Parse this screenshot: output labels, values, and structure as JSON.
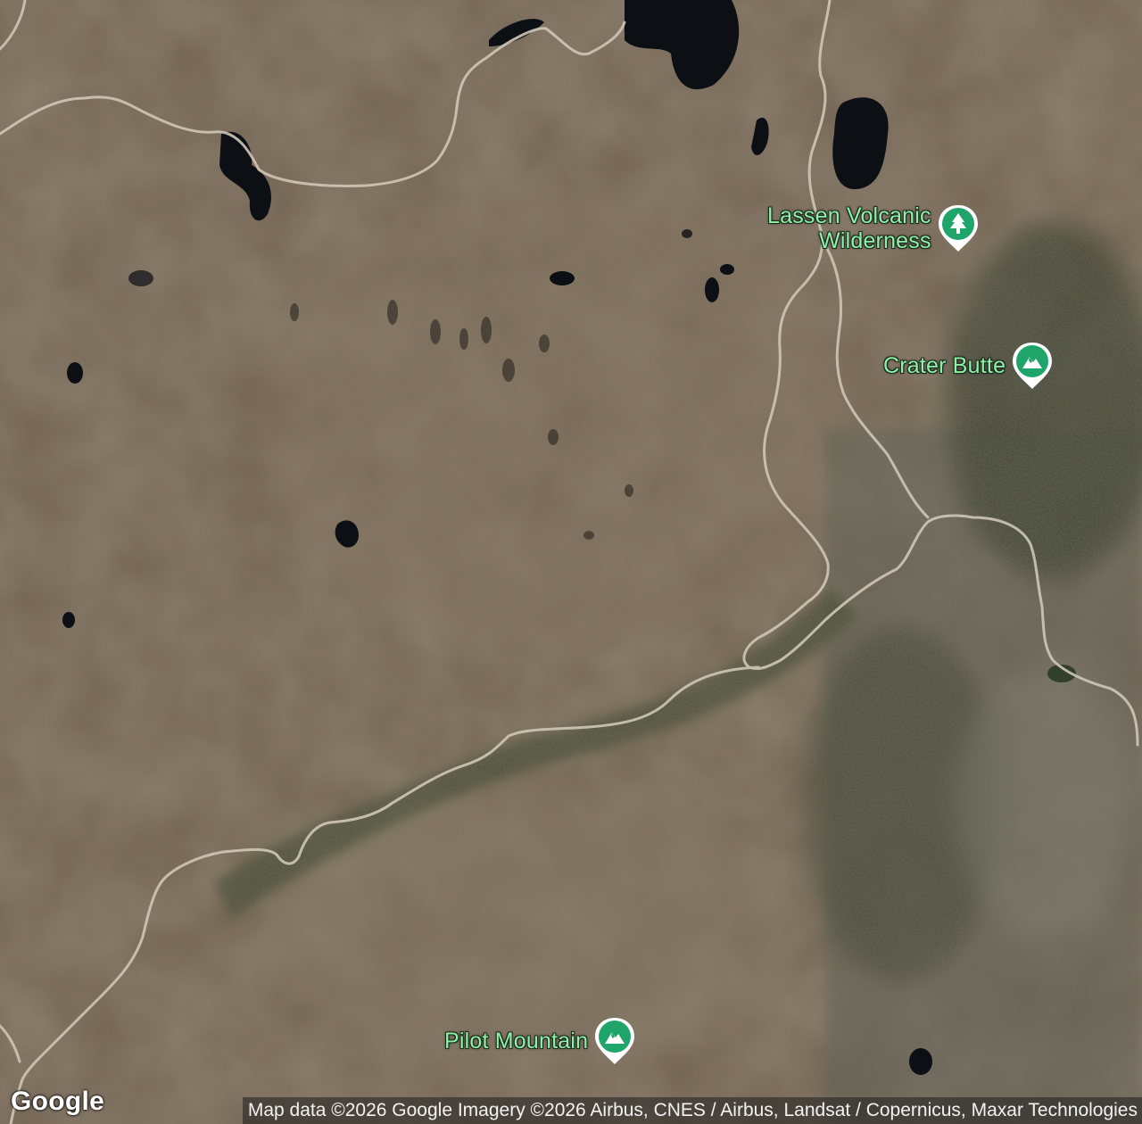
{
  "map": {
    "type": "satellite",
    "colors": {
      "terrain_base": "#6b5a48",
      "forest": "#3e4a35",
      "water": "#0d1115",
      "road": "#cfc6b7",
      "poi_label": "#8ff0a8",
      "poi_pin": "#1fa46a"
    },
    "pois": [
      {
        "name": "Lassen Volcanic\nWilderness",
        "line1": "Lassen Volcanic",
        "line2": "Wilderness",
        "icon": "tree-icon"
      },
      {
        "name": "Crater Butte",
        "icon": "mountain-icon"
      },
      {
        "name": "Pilot Mountain",
        "icon": "mountain-icon"
      }
    ]
  },
  "branding": {
    "logo_text": "Google"
  },
  "attribution": "Map data ©2026 Google Imagery ©2026 Airbus, CNES / Airbus, Landsat / Copernicus, Maxar Technologies"
}
